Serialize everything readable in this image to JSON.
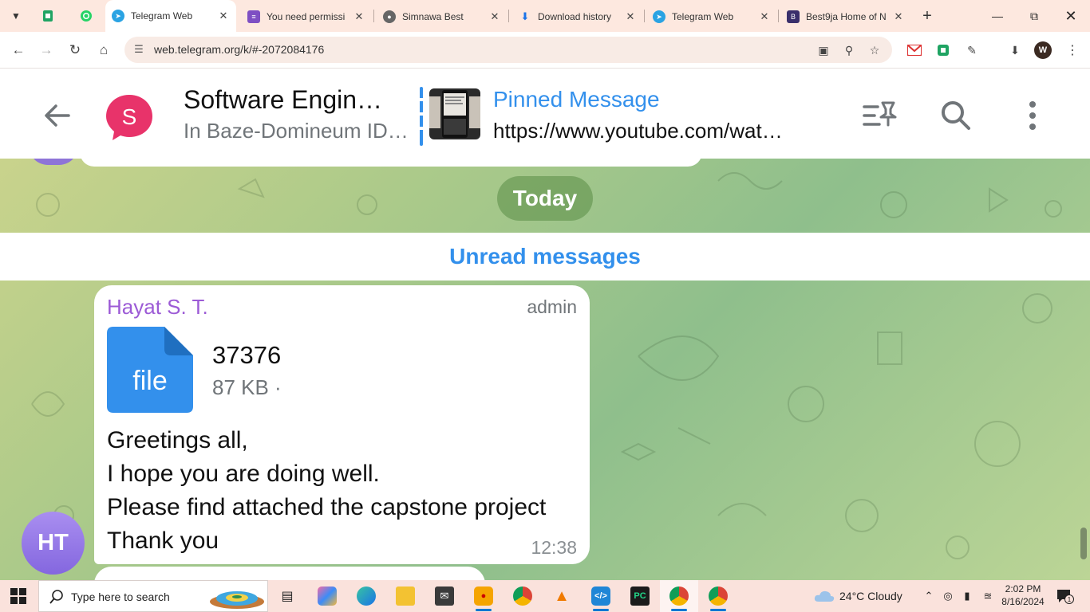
{
  "browser": {
    "tabs": [
      {
        "title": "Telegram Web",
        "active": true
      },
      {
        "title": "You need permissi",
        "active": false
      },
      {
        "title": "Simnawa Best",
        "active": false
      },
      {
        "title": "Download history",
        "active": false
      },
      {
        "title": "Telegram Web",
        "active": false
      },
      {
        "title": "Best9ja Home of N",
        "active": false
      }
    ],
    "url": "web.telegram.org/k/#-2072084176",
    "profile_initial": "W"
  },
  "chat": {
    "avatar_letter": "S",
    "title": "Software Engin…",
    "subtitle": "In Baze-Domineum ID…",
    "pinned": {
      "label": "Pinned Message",
      "text": "https://www.youtube.com/wat…"
    }
  },
  "date_separator": "Today",
  "unread_label": "Unread messages",
  "message": {
    "sender": "Hayat S. T.",
    "role": "admin",
    "file": {
      "icon_label": "file",
      "name": "37376",
      "size": "87 KB ·"
    },
    "lines": [
      "Greetings all,",
      "I hope you are doing well.",
      "Please find attached the capstone project",
      "Thank you"
    ],
    "time": "12:38",
    "avatar_initials": "HT"
  },
  "taskbar": {
    "search_placeholder": "Type here to search",
    "weather": "24°C  Cloudy",
    "time": "2:02 PM",
    "date": "8/16/2024",
    "notification_count": "1"
  },
  "colors": {
    "telegram_blue": "#3390ec",
    "sender_purple": "#9c5bd6",
    "chat_avatar_pink": "#e8336a",
    "tab_strip": "#fde8df"
  }
}
